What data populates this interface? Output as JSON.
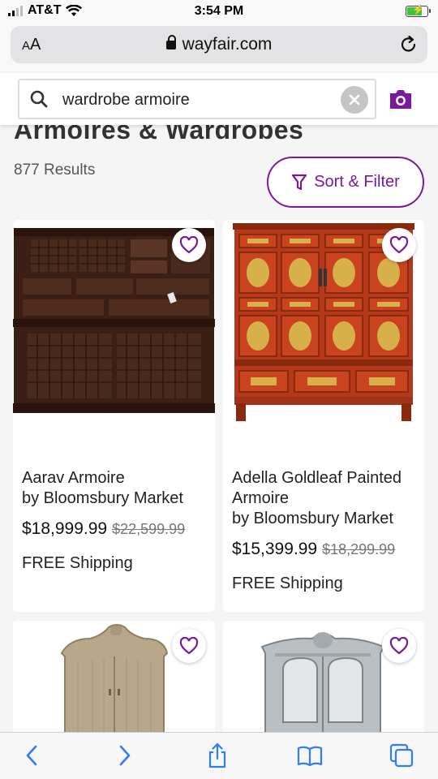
{
  "status": {
    "carrier": "AT&T",
    "time": "3:54 PM"
  },
  "browser": {
    "aa_label": "AA",
    "url": "wayfair.com"
  },
  "search": {
    "query": "wardrobe armoire"
  },
  "page": {
    "title": "Armoires & Wardrobes",
    "results": "877 Results",
    "sort_filter_label": "Sort & Filter"
  },
  "products": [
    {
      "name_line1": "Aarav Armoire",
      "name_line2": "by Bloomsbury Market",
      "price": "$18,999.99",
      "old_price": "$22,599.99",
      "shipping": "FREE Shipping"
    },
    {
      "name_line1": "Adella Goldleaf Painted",
      "name_line2": "Armoire",
      "name_line3": "by Bloomsbury Market",
      "price": "$15,399.99",
      "old_price": "$18,299.99",
      "shipping": "FREE Shipping"
    }
  ],
  "colors": {
    "brand_purple": "#7b189f",
    "heart_purple": "#7b189f"
  }
}
